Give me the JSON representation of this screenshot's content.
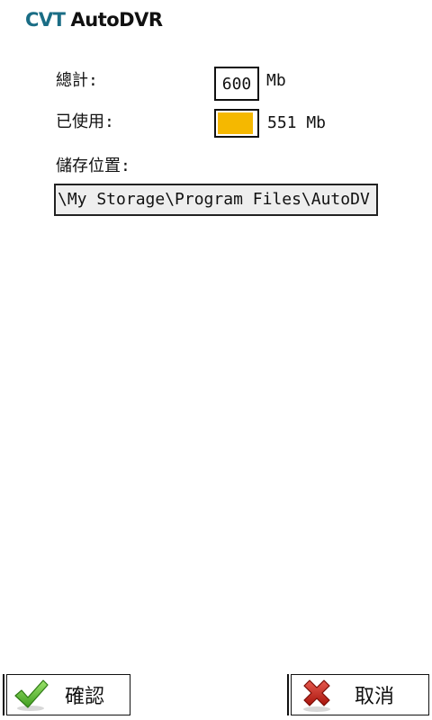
{
  "header": {
    "brand_part1": "CVT",
    "brand_part2": "AutoDVR"
  },
  "storage": {
    "total_label": "總計:",
    "total_value": "600",
    "total_unit": "Mb",
    "used_label": "已使用:",
    "used_text": "551 Mb",
    "used_fraction": 0.918,
    "used_color": "#f5b800",
    "location_label": "儲存位置:",
    "location_value": "\\My Storage\\Program Files\\AutoDV"
  },
  "buttons": {
    "ok_label": "確認",
    "ok_icon": "checkmark-icon",
    "cancel_label": "取消",
    "cancel_icon": "x-icon"
  }
}
